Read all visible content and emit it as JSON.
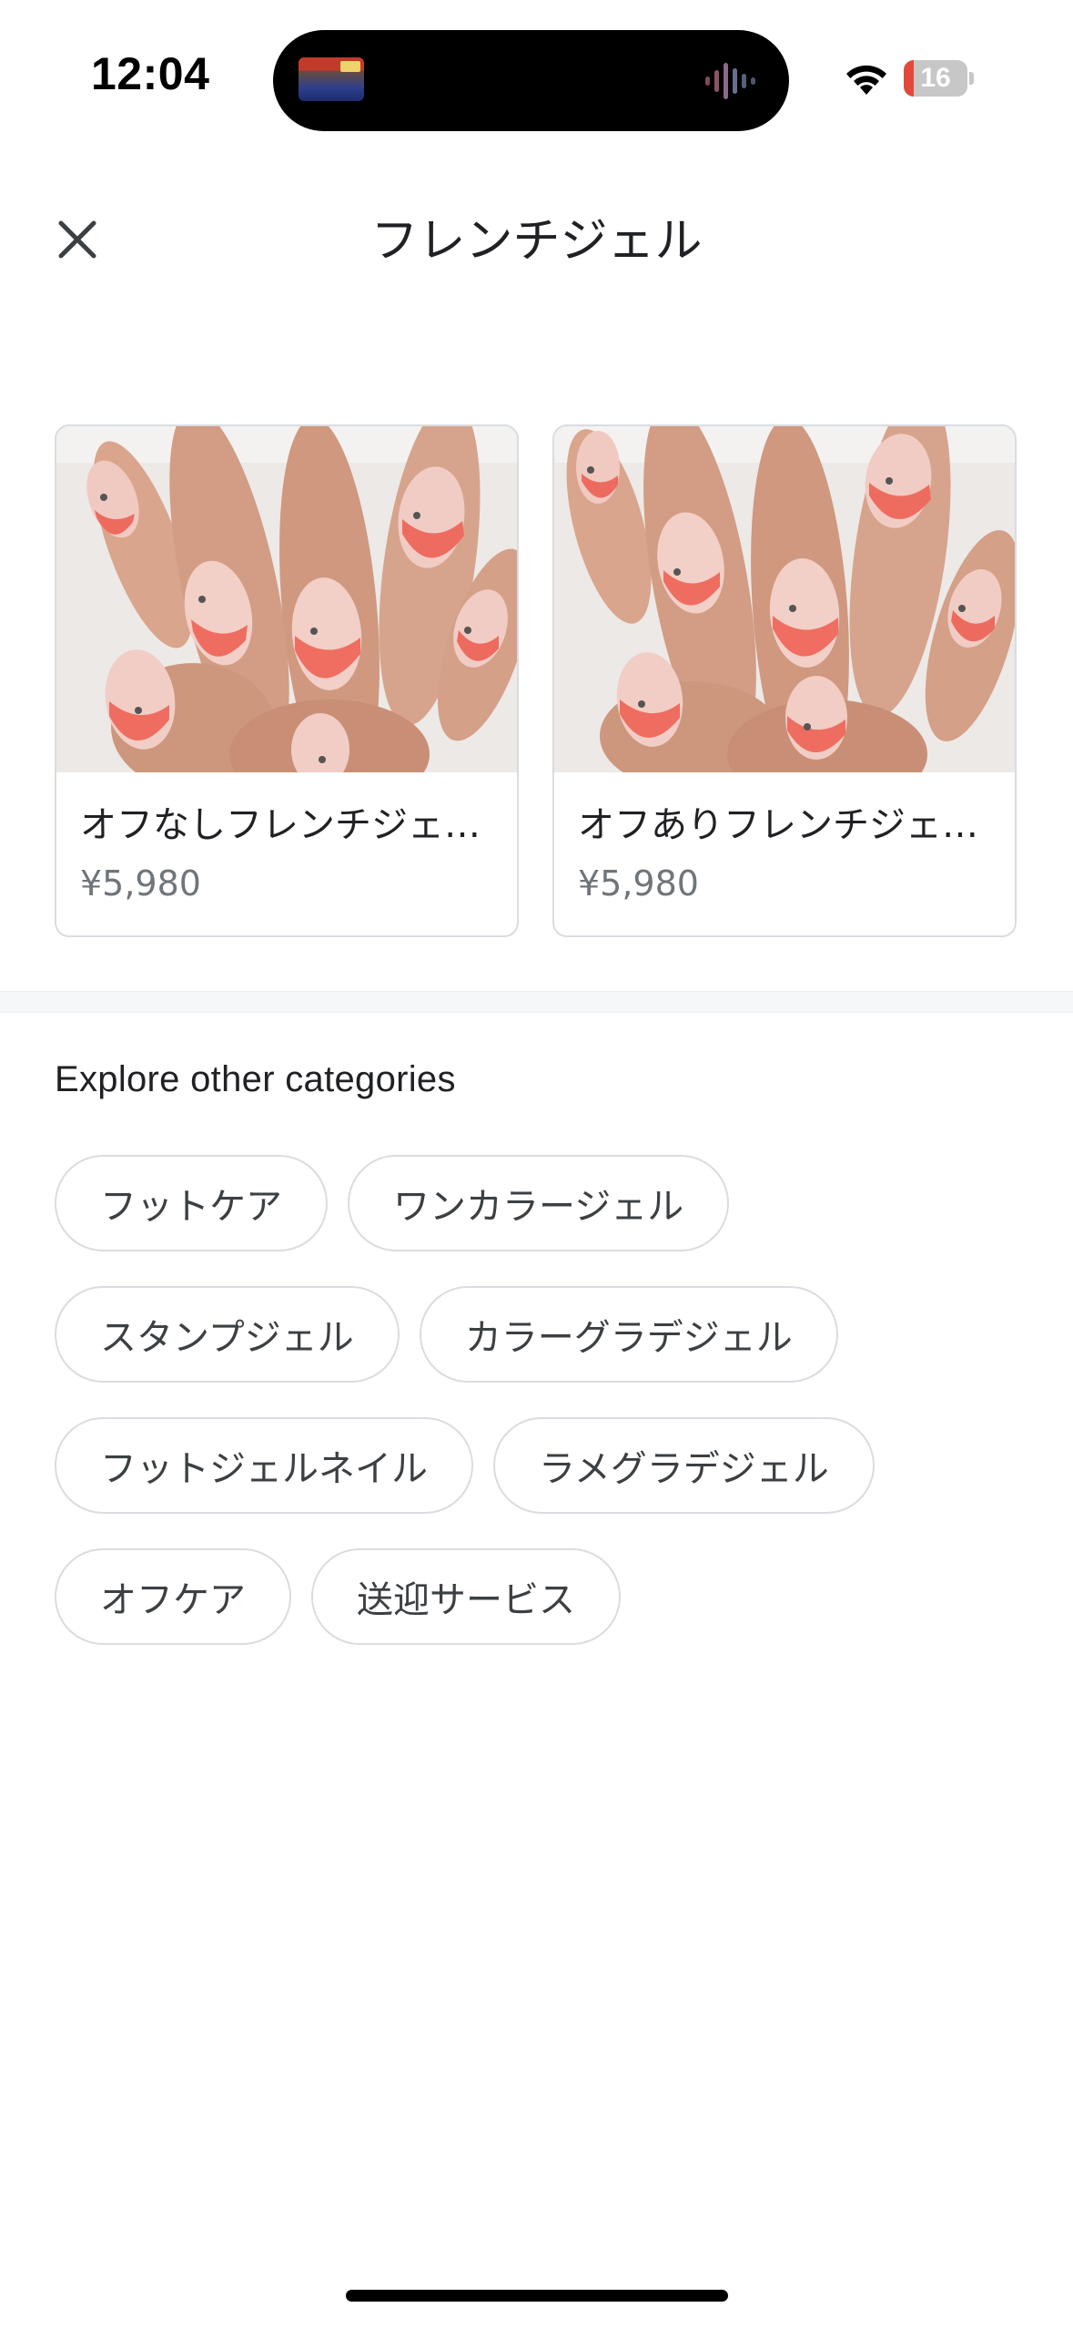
{
  "status_bar": {
    "time": "12:04",
    "battery_level": "16",
    "battery_fraction": 0.16,
    "battery_color": "#e3493b",
    "icons": [
      "wifi-icon",
      "battery-icon",
      "live-activity-thumbnail",
      "audio-wave-icon"
    ]
  },
  "header": {
    "title": "フレンチジェル",
    "close_icon": "close-icon"
  },
  "products": [
    {
      "name": "オフなしフレンチジェ…",
      "price": "¥5,980"
    },
    {
      "name": "オフありフレンチジェ…",
      "price": "¥5,980"
    }
  ],
  "categories": {
    "title": "Explore other categories",
    "rows": [
      [
        "フットケア",
        "ワンカラージェル"
      ],
      [
        "スタンプジェル",
        "カラーグラデジェル"
      ],
      [
        "フットジェルネイル",
        "ラメグラデジェル"
      ],
      [
        "オフケア",
        "送迎サービス"
      ]
    ]
  }
}
